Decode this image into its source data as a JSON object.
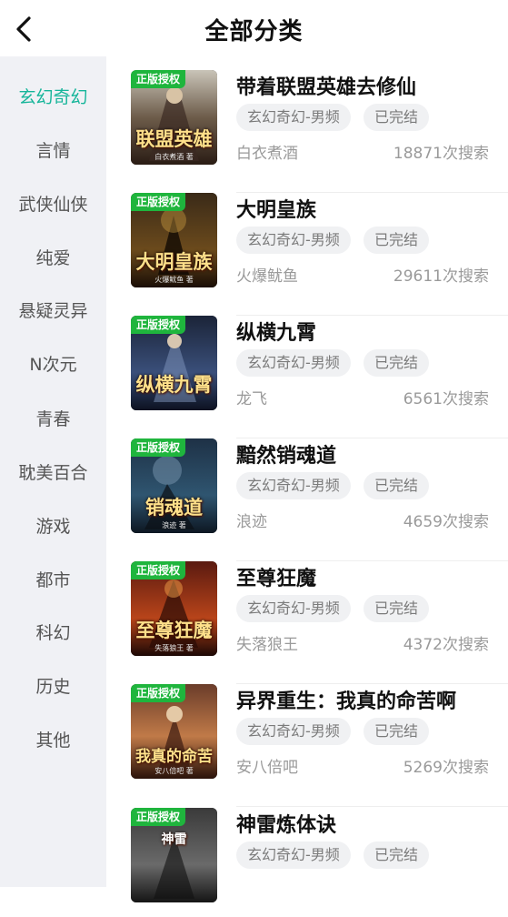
{
  "header": {
    "title": "全部分类"
  },
  "sidebar": {
    "items": [
      {
        "label": "玄幻奇幻",
        "active": true
      },
      {
        "label": "言情"
      },
      {
        "label": "武侠仙侠"
      },
      {
        "label": "纯爱"
      },
      {
        "label": "悬疑灵异"
      },
      {
        "label": "N次元"
      },
      {
        "label": "青春"
      },
      {
        "label": "耽美百合"
      },
      {
        "label": "游戏"
      },
      {
        "label": "都市"
      },
      {
        "label": "科幻"
      },
      {
        "label": "历史"
      },
      {
        "label": "其他"
      }
    ],
    "active_color": "#16b59a"
  },
  "books": [
    {
      "badge": "正版授权",
      "cover_text": "联盟英雄",
      "cover_author": "白衣煮酒 著",
      "title": "带着联盟英雄去修仙",
      "genre": "玄幻奇幻-男频",
      "status": "已完结",
      "author": "白衣煮酒",
      "searches": "18871次搜索"
    },
    {
      "badge": "正版授权",
      "cover_text": "大明皇族",
      "cover_author": "火爆鱿鱼 著",
      "title": "大明皇族",
      "genre": "玄幻奇幻-男频",
      "status": "已完结",
      "author": "火爆鱿鱼",
      "searches": "29611次搜索"
    },
    {
      "badge": "正版授权",
      "cover_text": "纵横九霄",
      "cover_author": "",
      "title": "纵横九霄",
      "genre": "玄幻奇幻-男频",
      "status": "已完结",
      "author": "龙飞",
      "searches": "6561次搜索"
    },
    {
      "badge": "正版授权",
      "cover_text": "销魂道",
      "cover_author": "浪迹 著",
      "title": "黯然销魂道",
      "genre": "玄幻奇幻-男频",
      "status": "已完结",
      "author": "浪迹",
      "searches": "4659次搜索"
    },
    {
      "badge": "正版授权",
      "cover_text": "至尊狂魔",
      "cover_author": "失落狼王 著",
      "title": "至尊狂魔",
      "genre": "玄幻奇幻-男频",
      "status": "已完结",
      "author": "失落狼王",
      "searches": "4372次搜索"
    },
    {
      "badge": "正版授权",
      "cover_text": "我真的命苦",
      "cover_author": "安八倍吧 著",
      "title": "异界重生：我真的命苦啊",
      "genre": "玄幻奇幻-男频",
      "status": "已完结",
      "author": "安八倍吧",
      "searches": "5269次搜索"
    },
    {
      "badge": "正版授权",
      "cover_text": "神雷",
      "cover_author": "",
      "title": "神雷炼体诀",
      "genre": "玄幻奇幻-男频",
      "status": "已完结",
      "author": "",
      "searches": ""
    }
  ]
}
